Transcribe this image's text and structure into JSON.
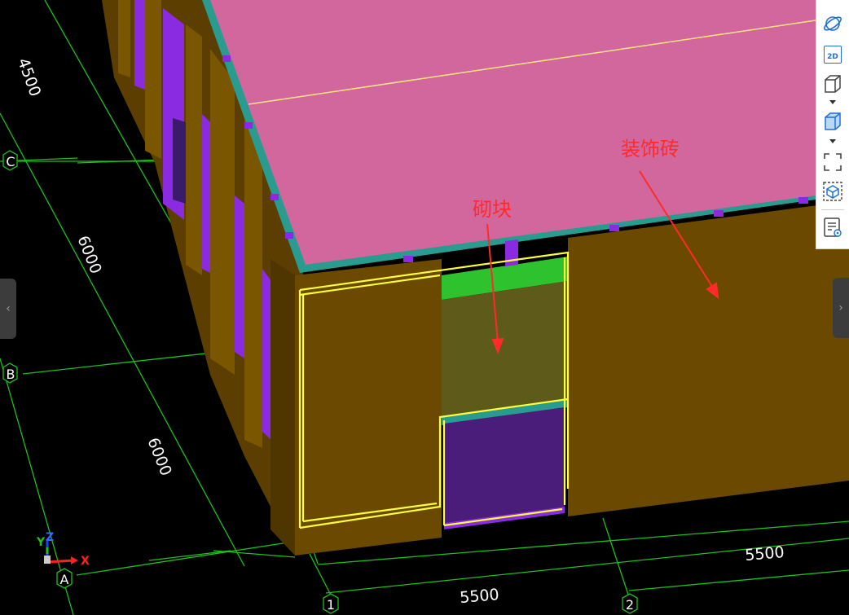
{
  "annotations": {
    "block_label": "砌块",
    "tile_label": "装饰砖"
  },
  "grid": {
    "axis_labels": {
      "c": "C",
      "b": "B",
      "a": "A",
      "one": "1",
      "two": "2"
    },
    "dimensions": {
      "d1": "4500",
      "d2": "6000",
      "d3": "6000",
      "d4": "5500",
      "d5": "5500"
    }
  },
  "axes_gizmo": {
    "x": "X",
    "y": "Y",
    "z": "Z"
  },
  "toolbar": {
    "view_2d_label": "2D",
    "tools": [
      "orbit-view",
      "2d-view",
      "3d-view",
      "view-cube",
      "fit-view",
      "section-box",
      "property-panel"
    ]
  },
  "side_tabs": {
    "left_arrow": "‹",
    "right_arrow": "›"
  },
  "colors": {
    "background": "#000000",
    "grid": "#1fbf1f",
    "roof": "#d1679c",
    "roof_edge": "#2a9b8f",
    "wall": "#6b4a00",
    "purple": "#8a2be2",
    "block_green": "#2ec22e",
    "block_olive": "#5e5a1a",
    "highlight": "#ffff3a",
    "annotation": "#ff2a2a"
  }
}
